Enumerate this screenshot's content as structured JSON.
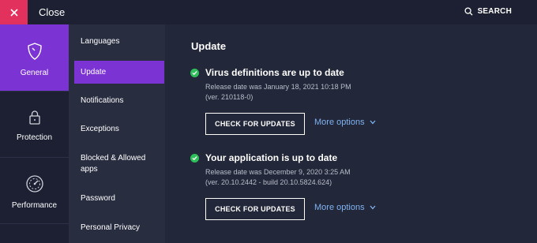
{
  "topbar": {
    "close_label": "Close",
    "search_label": "SEARCH"
  },
  "rail": {
    "items": [
      {
        "label": "General",
        "icon": "shield-icon",
        "active": true
      },
      {
        "label": "Protection",
        "icon": "lock-icon",
        "active": false
      },
      {
        "label": "Performance",
        "icon": "gauge-icon",
        "active": false
      }
    ]
  },
  "subnav": {
    "items": [
      {
        "label": "Languages"
      },
      {
        "label": "Update",
        "active": true
      },
      {
        "label": "Notifications"
      },
      {
        "label": "Exceptions"
      },
      {
        "label": "Blocked & Allowed apps"
      },
      {
        "label": "Password"
      },
      {
        "label": "Personal Privacy"
      }
    ]
  },
  "main": {
    "title": "Update",
    "sections": [
      {
        "heading": "Virus definitions are up to date",
        "line1": "Release date was January 18, 2021 10:18 PM",
        "line2": "(ver. 210118-0)",
        "button": "CHECK FOR UPDATES",
        "more": "More options"
      },
      {
        "heading": "Your application is up to date",
        "line1": "Release date was December 9, 2020 3:25 AM",
        "line2": "(ver. 20.10.2442 - build 20.10.5824.624)",
        "button": "CHECK FOR UPDATES",
        "more": "More options"
      }
    ]
  },
  "colors": {
    "accent": "#7b33d3",
    "close": "#e3315d",
    "success": "#2fbf5a",
    "link": "#7fb2f0"
  }
}
